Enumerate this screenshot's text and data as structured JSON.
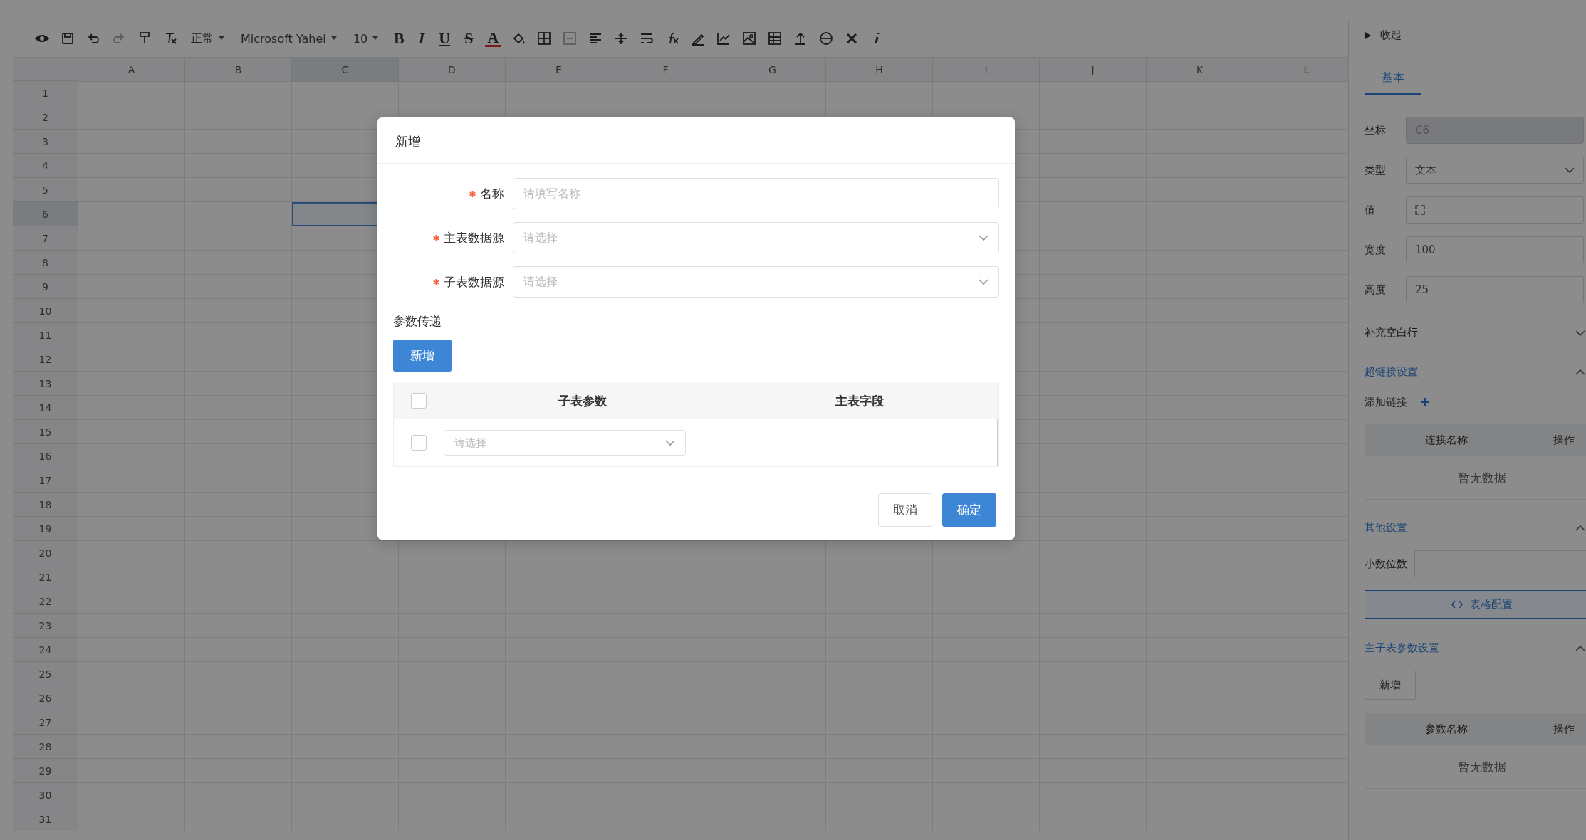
{
  "toolbar": {
    "style_select": "正常",
    "font_select": "Microsoft Yahei",
    "size_select": "10",
    "format_buttons": [
      "B",
      "I",
      "U",
      "S",
      "A"
    ]
  },
  "sheet": {
    "columns": [
      {
        "label": "A",
        "selected": false
      },
      {
        "label": "B",
        "selected": false
      },
      {
        "label": "C",
        "selected": true
      },
      {
        "label": "D",
        "selected": false
      },
      {
        "label": "E",
        "selected": false
      },
      {
        "label": "F",
        "selected": false
      },
      {
        "label": "G",
        "selected": false
      },
      {
        "label": "H",
        "selected": false
      },
      {
        "label": "I",
        "selected": false
      },
      {
        "label": "J",
        "selected": false
      },
      {
        "label": "K",
        "selected": false
      },
      {
        "label": "L",
        "selected": false
      }
    ],
    "rows": [
      {
        "label": "1",
        "selected": false
      },
      {
        "label": "2",
        "selected": false
      },
      {
        "label": "3",
        "selected": false
      },
      {
        "label": "4",
        "selected": false
      },
      {
        "label": "5",
        "selected": false
      },
      {
        "label": "6",
        "selected": true
      },
      {
        "label": "7",
        "selected": false
      },
      {
        "label": "8",
        "selected": false
      },
      {
        "label": "9",
        "selected": false
      },
      {
        "label": "10",
        "selected": false
      },
      {
        "label": "11",
        "selected": false
      },
      {
        "label": "12",
        "selected": false
      },
      {
        "label": "13",
        "selected": false
      },
      {
        "label": "14",
        "selected": false
      },
      {
        "label": "15",
        "selected": false
      },
      {
        "label": "16",
        "selected": false
      },
      {
        "label": "17",
        "selected": false
      },
      {
        "label": "18",
        "selected": false
      },
      {
        "label": "19",
        "selected": false
      },
      {
        "label": "20",
        "selected": false
      },
      {
        "label": "21",
        "selected": false
      },
      {
        "label": "22",
        "selected": false
      },
      {
        "label": "23",
        "selected": false
      },
      {
        "label": "24",
        "selected": false
      },
      {
        "label": "25",
        "selected": false
      },
      {
        "label": "26",
        "selected": false
      },
      {
        "label": "27",
        "selected": false
      },
      {
        "label": "28",
        "selected": false
      },
      {
        "label": "29",
        "selected": false
      },
      {
        "label": "30",
        "selected": false
      },
      {
        "label": "31",
        "selected": false
      }
    ]
  },
  "panel": {
    "collapse_label": "收起",
    "tabs": [
      {
        "label": "基本",
        "selected": true
      }
    ],
    "fields": [
      {
        "label": "坐标",
        "kind": "input",
        "value": "C6",
        "disabled": true
      },
      {
        "label": "类型",
        "kind": "select",
        "value": "文本",
        "disabled": false
      },
      {
        "label": "值",
        "kind": "expand",
        "disabled": false
      },
      {
        "label": "宽度",
        "kind": "input",
        "value": "100",
        "disabled": false
      },
      {
        "label": "高度",
        "kind": "input",
        "value": "25",
        "disabled": false
      }
    ],
    "sections": [
      {
        "kind": "collapse",
        "title": "补充空白行",
        "expanded": false
      },
      {
        "kind": "links",
        "title": "超链接设置",
        "expanded": true,
        "add_label": "添加链接",
        "table": {
          "columns": [
            "连接名称",
            "操作"
          ],
          "empty": "暂无数据"
        }
      },
      {
        "kind": "other",
        "title": "其他设置",
        "expanded": true,
        "field_label": "小数位数",
        "button": "表格配置"
      },
      {
        "kind": "params",
        "title": "主子表参数设置",
        "expanded": true,
        "add_button": "新增",
        "table": {
          "columns": [
            "参数名称",
            "操作"
          ],
          "empty": "暂无数据"
        }
      }
    ]
  },
  "dialog": {
    "title": "新增",
    "fields": [
      {
        "label": "名称",
        "kind": "input",
        "required": true,
        "placeholder": "请填写名称"
      },
      {
        "label": "主表数据源",
        "kind": "select",
        "required": true,
        "placeholder": "请选择"
      },
      {
        "label": "子表数据源",
        "kind": "select",
        "required": true,
        "placeholder": "请选择"
      }
    ],
    "section_label": "参数传递",
    "add_button": "新增",
    "table": {
      "columns": [
        "子表参数",
        "主表字段"
      ],
      "header_checked": false,
      "rows": [
        {
          "checked": false,
          "placeholder": "请选择"
        }
      ]
    },
    "buttons": [
      {
        "label": "取消",
        "kind": "default"
      },
      {
        "label": "确定",
        "kind": "primary"
      }
    ]
  }
}
